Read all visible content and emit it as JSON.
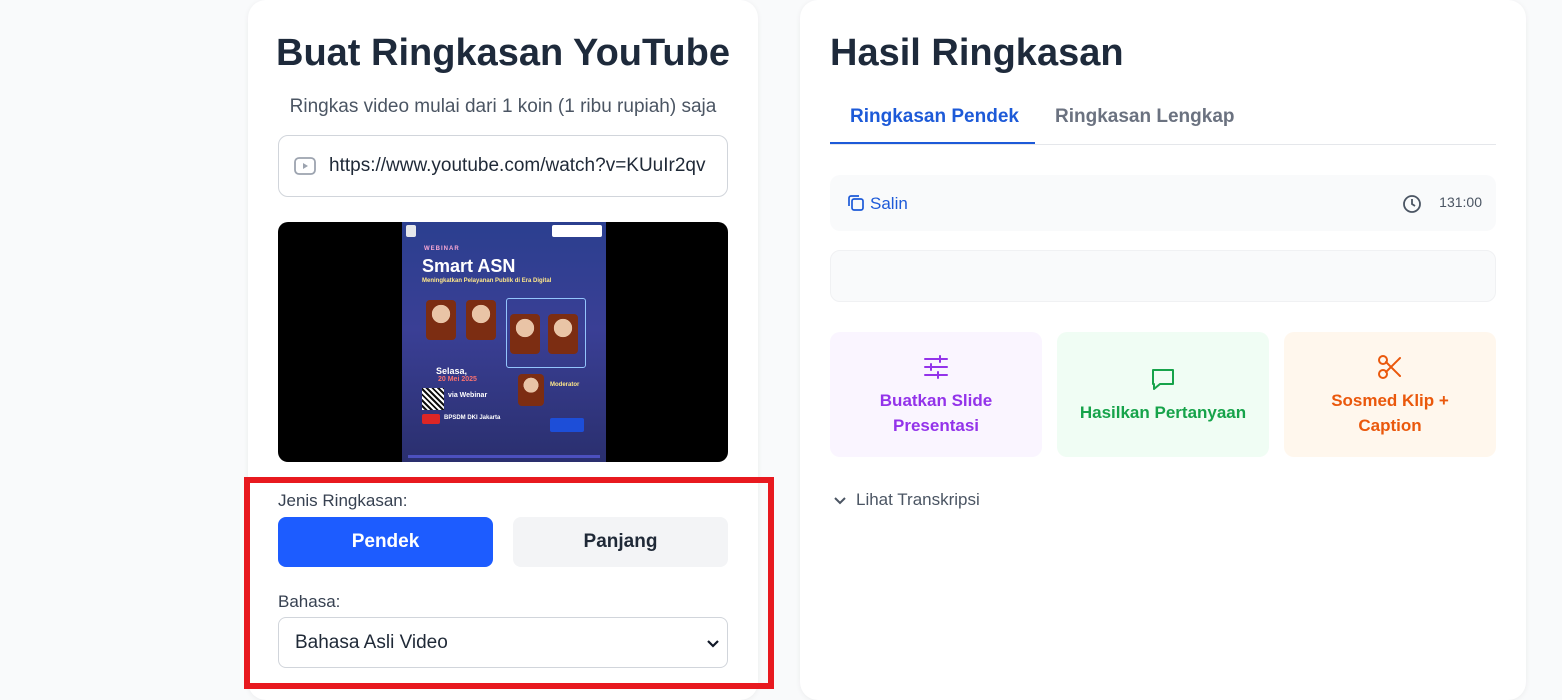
{
  "left": {
    "title": "Buat Ringkasan YouTube",
    "subtitle": "Ringkas video mulai dari 1 koin (1 ribu rupiah) saja",
    "url_value": "https://www.youtube.com/watch?v=KUuIr2qv",
    "thumbnail": {
      "tag": "WEBINAR",
      "title": "Smart ASN",
      "subtitle": "Meningkatkan Pelayanan Publik di Era Digital",
      "date_day": "Selasa,",
      "date": "20 Mei 2025",
      "via": "via Webinar",
      "channel": "BPSDM DKI Jakarta",
      "moderator": "Moderator"
    },
    "jenis_label": "Jenis Ringkasan:",
    "btn_pendek": "Pendek",
    "btn_panjang": "Panjang",
    "bahasa_label": "Bahasa:",
    "bahasa_selected": "Bahasa Asli Video"
  },
  "right": {
    "title": "Hasil Ringkasan",
    "tab_active": "Ringkasan Pendek",
    "tab_inactive": "Ringkasan Lengkap",
    "copy_label": "Salin",
    "duration": "131:00",
    "actions": [
      {
        "label": "Buatkan Slide Presentasi",
        "color": "#9333ea"
      },
      {
        "label": "Hasilkan Pertanyaan",
        "color": "#16a34a"
      },
      {
        "label": "Sosmed Klip + Caption",
        "color": "#ea580c"
      }
    ],
    "transcript_label": "Lihat Transkripsi"
  },
  "colors": {
    "primary": "#1d5cff",
    "highlight": "#e8191f"
  }
}
